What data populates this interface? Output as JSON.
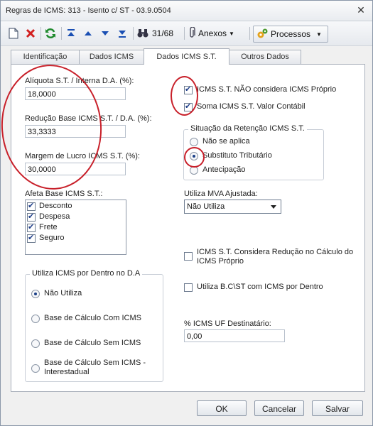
{
  "window": {
    "title": "Regras de ICMS: 313 - Isento c/ ST - 03.9.0504",
    "close": "✕"
  },
  "toolbar": {
    "record_counter": "31/68",
    "anexos_label": "Anexos",
    "processos_label": "Processos"
  },
  "tabs": [
    "Identificação",
    "Dados ICMS",
    "Dados ICMS S.T.",
    "Outros Dados"
  ],
  "left": {
    "aliquota_label": "Alíquota S.T. / Interna D.A. (%):",
    "aliquota_value": "18,0000",
    "reducao_label": "Redução Base ICMS S.T. / D.A. (%):",
    "reducao_value": "33,3333",
    "margem_label": "Margem de Lucro ICMS S.T. (%):",
    "margem_value": "30,0000",
    "afeta_label": "Afeta Base ICMS S.T.:",
    "afeta_items": [
      {
        "label": "Desconto",
        "checked": true
      },
      {
        "label": "Despesa",
        "checked": true
      },
      {
        "label": "Frete",
        "checked": true
      },
      {
        "label": "Seguro",
        "checked": true
      }
    ],
    "utiliza_group_title": "Utiliza ICMS por Dentro no D.A",
    "utiliza_options": [
      "Não Utiliza",
      "Base de Cálculo Com ICMS",
      "Base de Cálculo Sem ICMS",
      "Base de Cálculo Sem ICMS -",
      "Interestadual"
    ],
    "utiliza_selected": 0
  },
  "right": {
    "cb_nao_considera": "ICMS S.T. NÃO considera ICMS Próprio",
    "cb_soma": "Soma ICMS S.T. Valor Contábil",
    "situacao_title": "Situação da Retenção ICMS S.T.",
    "situacao_options": [
      "Não se aplica",
      "Substituto Tributário",
      "Antecipação"
    ],
    "situacao_selected": 1,
    "mva_label": "Utiliza MVA Ajustada:",
    "mva_value": "Não Utiliza",
    "cb_reducao_1": "ICMS S.T. Considera Redução no Cálculo do",
    "cb_reducao_2": "ICMS Próprio",
    "cb_bc_st": "Utiliza B.C\\ST com ICMS por Dentro",
    "uf_label": "% ICMS UF Destinatário:",
    "uf_value": "0,00"
  },
  "buttons": {
    "ok": "OK",
    "cancel": "Cancelar",
    "save": "Salvar"
  },
  "colors": {
    "annotation": "#c8202a",
    "accent": "#1f3f8a"
  },
  "icons": [
    "new-document-icon",
    "delete-icon",
    "refresh-icon",
    "first-record-icon",
    "previous-record-icon",
    "next-record-icon",
    "last-record-icon",
    "binoculars-icon",
    "paperclip-icon",
    "processes-icon"
  ]
}
